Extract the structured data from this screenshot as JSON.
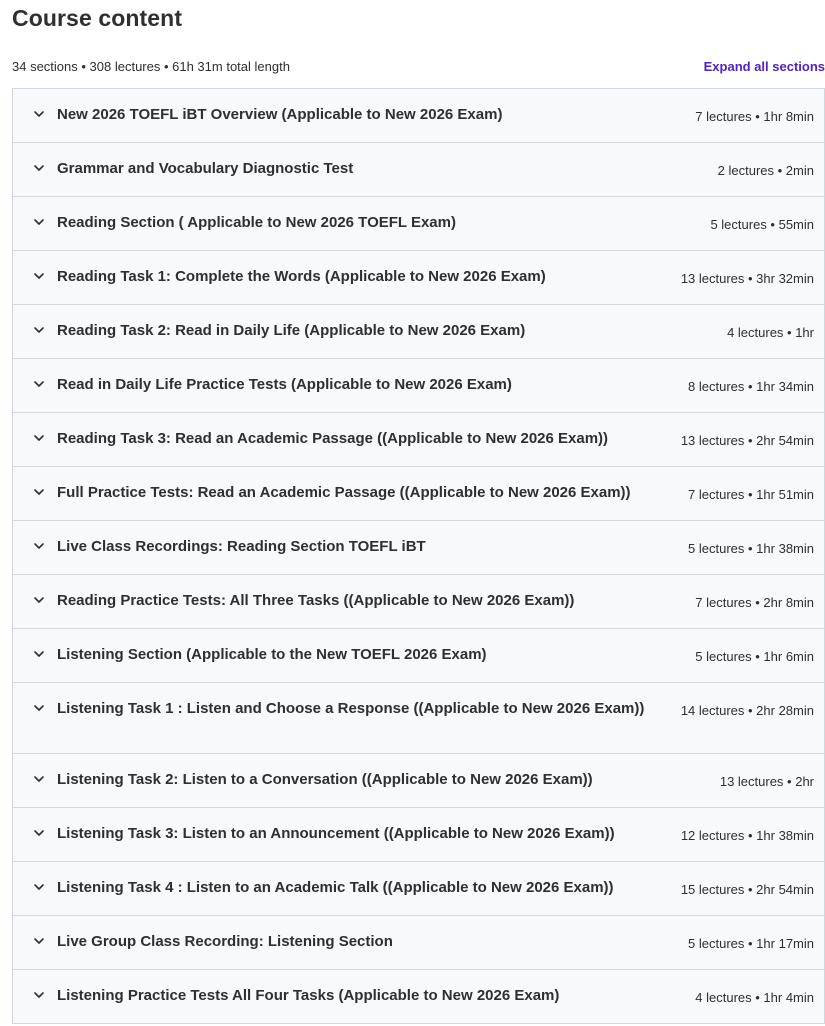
{
  "header": {
    "title": "Course content",
    "summary": "34 sections • 308 lectures • 61h 31m total length",
    "expand_all_label": "Expand all sections"
  },
  "icons": {
    "section_toggle": "chevron-down-icon"
  },
  "colors": {
    "accent": "#5022c3",
    "section_bg": "#f7f9fa",
    "border": "#d1d7dc",
    "text": "#2d2f31"
  },
  "sections": [
    {
      "title": "New 2026 TOEFL iBT Overview (Applicable to New 2026 Exam)",
      "meta": "7 lectures • 1hr 8min"
    },
    {
      "title": "Grammar and Vocabulary Diagnostic Test",
      "meta": "2 lectures • 2min"
    },
    {
      "title": "Reading Section ( Applicable to New 2026 TOEFL Exam)",
      "meta": "5 lectures • 55min"
    },
    {
      "title": "Reading Task 1: Complete the Words (Applicable to New 2026 Exam)",
      "meta": "13 lectures • 3hr 32min"
    },
    {
      "title": "Reading Task 2: Read in Daily Life (Applicable to New 2026 Exam)",
      "meta": "4 lectures • 1hr"
    },
    {
      "title": "Read in Daily Life Practice Tests (Applicable to New 2026 Exam)",
      "meta": "8 lectures • 1hr 34min"
    },
    {
      "title": "Reading Task 3: Read an Academic Passage ((Applicable to New 2026 Exam))",
      "meta": "13 lectures • 2hr 54min"
    },
    {
      "title": "Full Practice Tests: Read an Academic Passage ((Applicable to New 2026 Exam))",
      "meta": "7 lectures • 1hr 51min"
    },
    {
      "title": "Live Class Recordings: Reading Section TOEFL iBT",
      "meta": "5 lectures • 1hr 38min"
    },
    {
      "title": "Reading Practice Tests: All Three Tasks ((Applicable to New 2026 Exam))",
      "meta": "7 lectures • 2hr 8min"
    },
    {
      "title": "Listening Section (Applicable to the New TOEFL 2026 Exam)",
      "meta": "5 lectures • 1hr 6min"
    },
    {
      "title": "Listening Task 1 : Listen and Choose a Response ((Applicable to New 2026 Exam))",
      "meta": "14 lectures • 2hr 28min"
    },
    {
      "title": "Listening Task 2: Listen to a Conversation ((Applicable to New 2026 Exam))",
      "meta": "13 lectures • 2hr"
    },
    {
      "title": "Listening Task 3: Listen to an Announcement ((Applicable to New 2026 Exam))",
      "meta": "12 lectures • 1hr 38min"
    },
    {
      "title": "Listening Task 4 : Listen to an Academic Talk ((Applicable to New 2026 Exam))",
      "meta": "15 lectures • 2hr 54min"
    },
    {
      "title": "Live Group Class Recording: Listening Section",
      "meta": "5 lectures • 1hr 17min"
    },
    {
      "title": "Listening Practice Tests All Four Tasks (Applicable to New 2026 Exam)",
      "meta": "4 lectures • 1hr 4min"
    }
  ]
}
